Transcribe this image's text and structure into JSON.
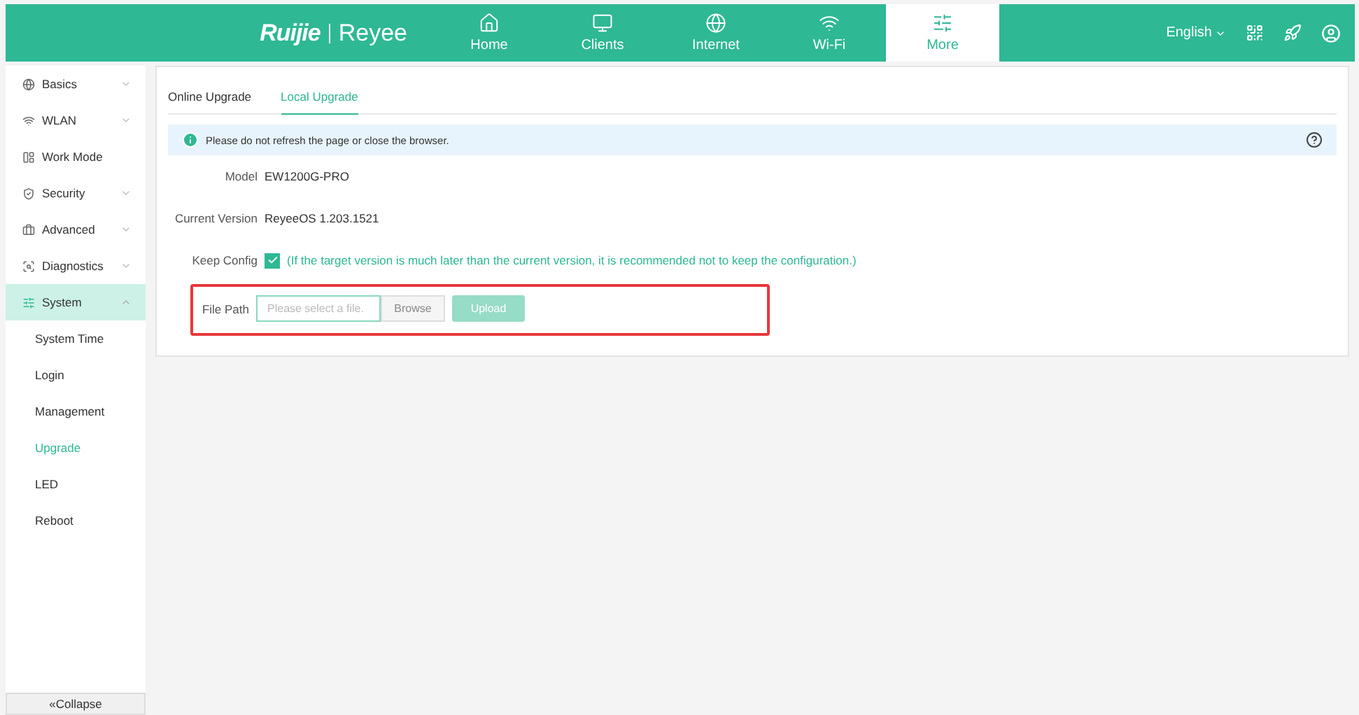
{
  "header": {
    "logo": {
      "brand": "Ruijie",
      "product": "Reyee"
    },
    "nav": [
      {
        "label": "Home",
        "selected": false
      },
      {
        "label": "Clients",
        "selected": false
      },
      {
        "label": "Internet",
        "selected": false
      },
      {
        "label": "Wi-Fi",
        "selected": false
      },
      {
        "label": "More",
        "selected": true
      }
    ],
    "language": "English"
  },
  "sidebar": {
    "items": [
      {
        "label": "Basics",
        "expanded": false,
        "selected": false
      },
      {
        "label": "WLAN",
        "expanded": false,
        "selected": false
      },
      {
        "label": "Work Mode",
        "selected": false
      },
      {
        "label": "Security",
        "expanded": false,
        "selected": false
      },
      {
        "label": "Advanced",
        "expanded": false,
        "selected": false
      },
      {
        "label": "Diagnostics",
        "expanded": false,
        "selected": false
      },
      {
        "label": "System",
        "expanded": true,
        "selected": true,
        "children": [
          {
            "label": "System Time",
            "selected": false
          },
          {
            "label": "Login",
            "selected": false
          },
          {
            "label": "Management",
            "selected": false
          },
          {
            "label": "Upgrade",
            "selected": true
          },
          {
            "label": "LED",
            "selected": false
          },
          {
            "label": "Reboot",
            "selected": false
          }
        ]
      }
    ],
    "collapse": {
      "glyph": "«",
      "label": "Collapse"
    }
  },
  "tabs": [
    {
      "label": "Online Upgrade",
      "selected": false
    },
    {
      "label": "Local Upgrade",
      "selected": true
    }
  ],
  "notice": "Please do not refresh the page or close the browser.",
  "fields": [
    {
      "label": "Model",
      "value": "EW1200G-PRO"
    },
    {
      "label": "Current Version",
      "value": "ReyeeOS 1.203.1521"
    }
  ],
  "keep_config": {
    "label": "Keep Config",
    "checked": true,
    "hint": "(If the target version is much later than the current version, it is recommended not to keep the configuration.)"
  },
  "file_path": {
    "label": "File Path",
    "placeholder": "Please select a file.",
    "browse": "Browse",
    "upload": "Upload",
    "upload_disabled": true,
    "highlighted": true
  }
}
